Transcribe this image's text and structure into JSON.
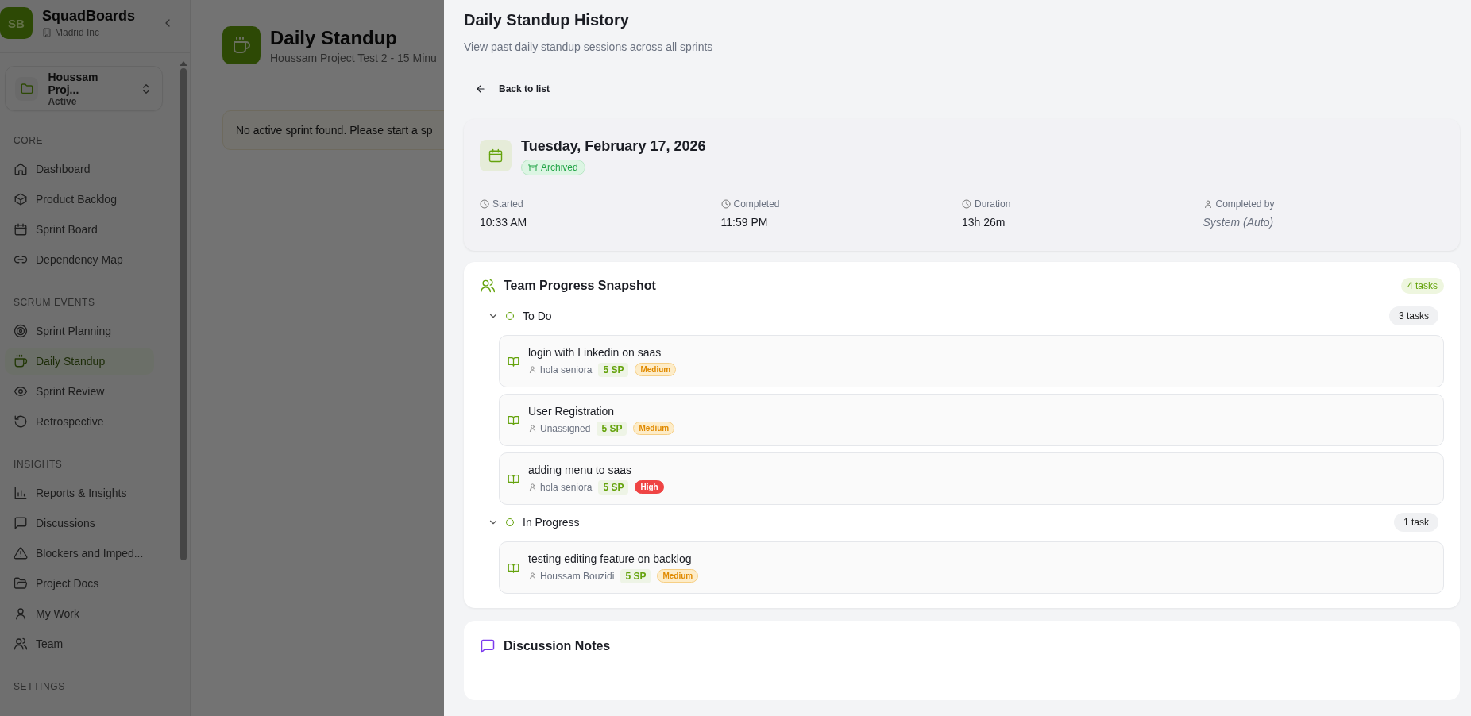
{
  "sidebar": {
    "brand": {
      "initials": "SB",
      "name": "SquadBoards",
      "org": "Madrid Inc"
    },
    "project": {
      "name": "Houssam Proj...",
      "status": "Active"
    },
    "sections": [
      {
        "title": "CORE",
        "items": [
          {
            "label": "Dashboard",
            "selected": false
          },
          {
            "label": "Product Backlog",
            "selected": false
          },
          {
            "label": "Sprint Board",
            "selected": false
          },
          {
            "label": "Dependency Map",
            "selected": false
          }
        ]
      },
      {
        "title": "SCRUM EVENTS",
        "items": [
          {
            "label": "Sprint Planning",
            "selected": false
          },
          {
            "label": "Daily Standup",
            "selected": true
          },
          {
            "label": "Sprint Review",
            "selected": false
          },
          {
            "label": "Retrospective",
            "selected": false
          }
        ]
      },
      {
        "title": "INSIGHTS",
        "items": [
          {
            "label": "Reports & Insights",
            "selected": false
          },
          {
            "label": "Discussions",
            "selected": false
          },
          {
            "label": "Blockers and Imped...",
            "selected": false
          },
          {
            "label": "Project Docs",
            "selected": false
          },
          {
            "label": "My Work",
            "selected": false
          },
          {
            "label": "Team",
            "selected": false
          }
        ]
      },
      {
        "title": "SETTINGS"
      }
    ]
  },
  "page": {
    "title": "Daily Standup",
    "subtitle": "Houssam Project Test 2 - 15 Minu",
    "alert": "No active sprint found. Please start a sp"
  },
  "panel": {
    "title": "Daily Standup History",
    "subtitle": "View past daily standup sessions across all sprints",
    "back_link": "Back to list",
    "session": {
      "date": "Tuesday, February 17, 2026",
      "status": "Archived",
      "stats": [
        {
          "label": "Started",
          "value": "10:33 AM",
          "kind": "value"
        },
        {
          "label": "Completed",
          "value": "11:59 PM",
          "kind": "value"
        },
        {
          "label": "Duration",
          "value": "13h 26m",
          "kind": "value"
        },
        {
          "label": "Completed by",
          "value": "System (Auto)",
          "kind": "auto"
        }
      ]
    },
    "team": {
      "title": "Team Progress Snapshot",
      "count": "4 tasks",
      "groups": [
        {
          "name": "To Do",
          "count": "3 tasks",
          "expanded": true,
          "tasks": [
            {
              "title": "login with Linkedin on saas",
              "assignee": "hola seniora",
              "points": "5 SP",
              "priority": {
                "text": "Medium",
                "kind": "medium"
              }
            },
            {
              "title": "User Registration",
              "assignee": "Unassigned",
              "points": "5 SP",
              "priority": {
                "text": "Medium",
                "kind": "medium"
              }
            },
            {
              "title": "adding menu to saas",
              "assignee": "hola seniora",
              "points": "5 SP",
              "priority": {
                "text": "High",
                "kind": "high"
              }
            }
          ]
        },
        {
          "name": "In Progress",
          "count": "1 task",
          "expanded": true,
          "tasks": [
            {
              "title": "testing editing feature on backlog",
              "assignee": "Houssam Bouzidi",
              "points": "5 SP",
              "priority": {
                "text": "Medium",
                "kind": "medium"
              }
            }
          ]
        }
      ]
    },
    "discussion": {
      "title": "Discussion Notes"
    }
  }
}
